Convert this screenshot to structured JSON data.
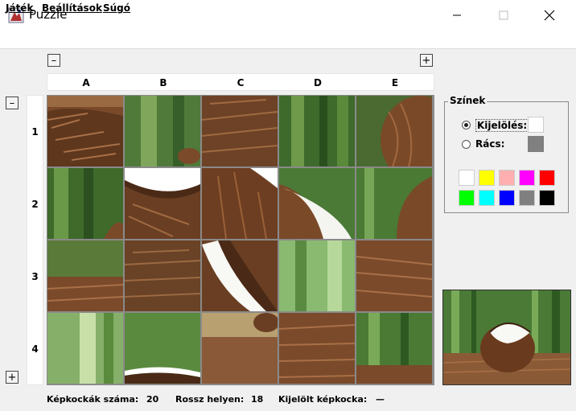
{
  "window": {
    "title": "Puzzle"
  },
  "menu": {
    "items": [
      "Játék",
      "Beállítások",
      "Súgó"
    ]
  },
  "buttons": {
    "minus": "–",
    "plus": "+"
  },
  "grid": {
    "columns": [
      "A",
      "B",
      "C",
      "D",
      "E"
    ],
    "rows": [
      "1",
      "2",
      "3",
      "4"
    ]
  },
  "colors": {
    "title": "Színek",
    "selection_label": "Kijelölés:",
    "grid_label": "Rács:",
    "selection_color": "#ffffff",
    "grid_color": "#808080",
    "palette": [
      "#ffffff",
      "#ffff00",
      "#ffafaf",
      "#ff00ff",
      "#ff0000",
      "#00ff00",
      "#00ffff",
      "#0000ff",
      "#808080",
      "#000000"
    ]
  },
  "status": {
    "tiles_label": "Képkockák száma:",
    "tiles_value": "20",
    "wrong_label": "Rossz helyen:",
    "wrong_value": "18",
    "selected_label": "Kijelölt képkocka:",
    "selected_value": "—"
  }
}
